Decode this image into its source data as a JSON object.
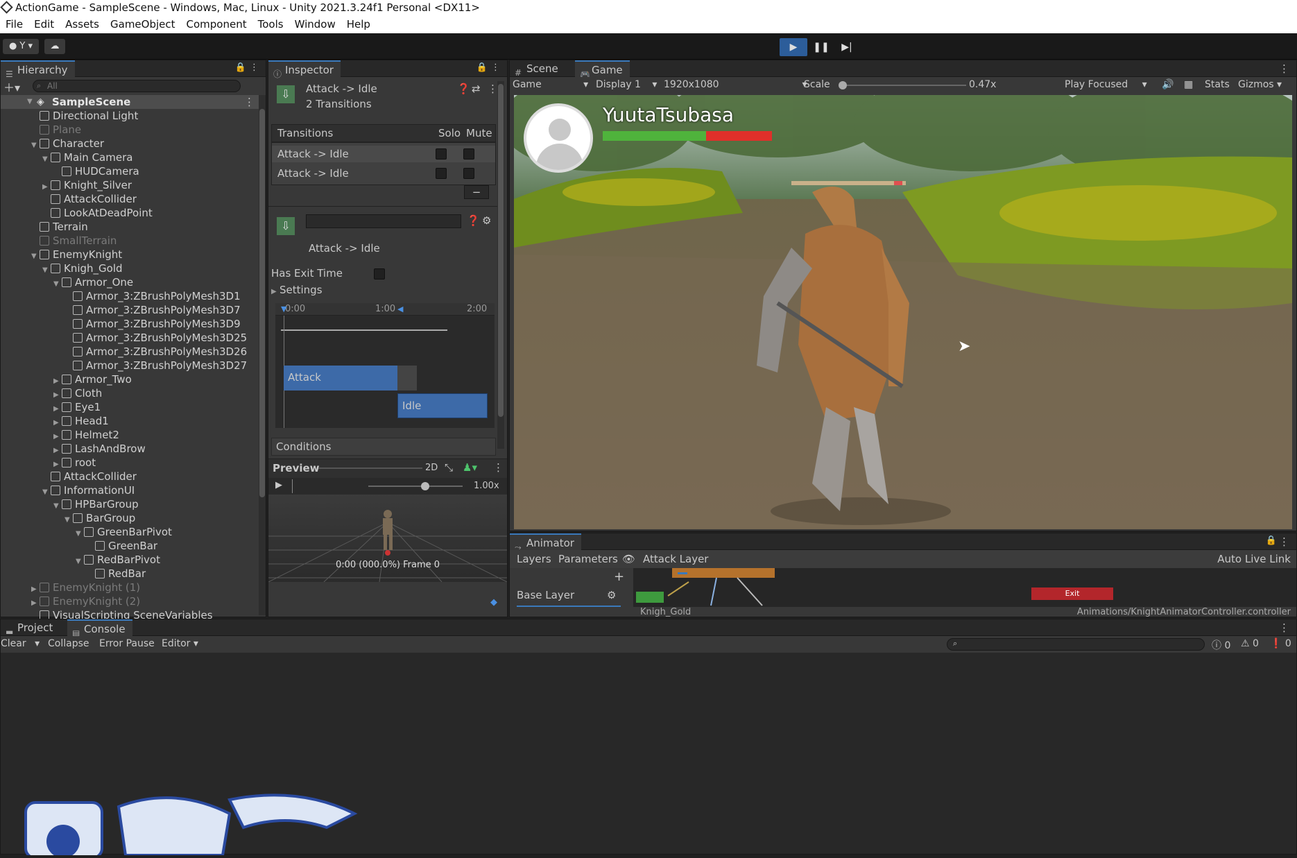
{
  "title_bar": {
    "text": "ActionGame - SampleScene - Windows, Mac, Linux - Unity 2021.3.24f1 Personal <DX11>"
  },
  "menu": [
    "File",
    "Edit",
    "Assets",
    "GameObject",
    "Component",
    "Tools",
    "Window",
    "Help"
  ],
  "toolbar": {
    "account_label": "Y",
    "play_icon": "play-icon",
    "pause_icon": "pause-icon",
    "step_icon": "step-icon"
  },
  "hierarchy": {
    "tab_label": "Hierarchy",
    "search_placeholder": "All",
    "scene_name": "SampleScene",
    "items": [
      {
        "label": "Directional Light",
        "depth": 1,
        "expand": "",
        "dim": false
      },
      {
        "label": "Plane",
        "depth": 1,
        "expand": "",
        "dim": true
      },
      {
        "label": "Character",
        "depth": 1,
        "expand": "open",
        "dim": false
      },
      {
        "label": "Main Camera",
        "depth": 2,
        "expand": "open",
        "dim": false
      },
      {
        "label": "HUDCamera",
        "depth": 3,
        "expand": "",
        "dim": false
      },
      {
        "label": "Knight_Silver",
        "depth": 2,
        "expand": "closed",
        "dim": false
      },
      {
        "label": "AttackCollider",
        "depth": 2,
        "expand": "",
        "dim": false
      },
      {
        "label": "LookAtDeadPoint",
        "depth": 2,
        "expand": "",
        "dim": false
      },
      {
        "label": "Terrain",
        "depth": 1,
        "expand": "",
        "dim": false
      },
      {
        "label": "SmallTerrain",
        "depth": 1,
        "expand": "",
        "dim": true
      },
      {
        "label": "EnemyKnight",
        "depth": 1,
        "expand": "open",
        "dim": false
      },
      {
        "label": "Knigh_Gold",
        "depth": 2,
        "expand": "open",
        "dim": false
      },
      {
        "label": "Armor_One",
        "depth": 3,
        "expand": "open",
        "dim": false
      },
      {
        "label": "Armor_3:ZBrushPolyMesh3D1",
        "depth": 4,
        "expand": "",
        "dim": false
      },
      {
        "label": "Armor_3:ZBrushPolyMesh3D7",
        "depth": 4,
        "expand": "",
        "dim": false
      },
      {
        "label": "Armor_3:ZBrushPolyMesh3D9",
        "depth": 4,
        "expand": "",
        "dim": false
      },
      {
        "label": "Armor_3:ZBrushPolyMesh3D25",
        "depth": 4,
        "expand": "",
        "dim": false
      },
      {
        "label": "Armor_3:ZBrushPolyMesh3D26",
        "depth": 4,
        "expand": "",
        "dim": false
      },
      {
        "label": "Armor_3:ZBrushPolyMesh3D27",
        "depth": 4,
        "expand": "",
        "dim": false
      },
      {
        "label": "Armor_Two",
        "depth": 3,
        "expand": "closed",
        "dim": false
      },
      {
        "label": "Cloth",
        "depth": 3,
        "expand": "closed",
        "dim": false
      },
      {
        "label": "Eye1",
        "depth": 3,
        "expand": "closed",
        "dim": false
      },
      {
        "label": "Head1",
        "depth": 3,
        "expand": "closed",
        "dim": false
      },
      {
        "label": "Helmet2",
        "depth": 3,
        "expand": "closed",
        "dim": false
      },
      {
        "label": "LashAndBrow",
        "depth": 3,
        "expand": "closed",
        "dim": false
      },
      {
        "label": "root",
        "depth": 3,
        "expand": "closed",
        "dim": false
      },
      {
        "label": "AttackCollider",
        "depth": 2,
        "expand": "",
        "dim": false
      },
      {
        "label": "InformationUI",
        "depth": 2,
        "expand": "open",
        "dim": false
      },
      {
        "label": "HPBarGroup",
        "depth": 3,
        "expand": "open",
        "dim": false
      },
      {
        "label": "BarGroup",
        "depth": 4,
        "expand": "open",
        "dim": false
      },
      {
        "label": "GreenBarPivot",
        "depth": 5,
        "expand": "open",
        "dim": false
      },
      {
        "label": "GreenBar",
        "depth": 6,
        "expand": "",
        "dim": false
      },
      {
        "label": "RedBarPivot",
        "depth": 5,
        "expand": "open",
        "dim": false
      },
      {
        "label": "RedBar",
        "depth": 6,
        "expand": "",
        "dim": false
      },
      {
        "label": "EnemyKnight (1)",
        "depth": 1,
        "expand": "closed",
        "dim": true
      },
      {
        "label": "EnemyKnight (2)",
        "depth": 1,
        "expand": "closed",
        "dim": true
      },
      {
        "label": "VisualScripting SceneVariables",
        "depth": 1,
        "expand": "",
        "dim": false
      }
    ]
  },
  "inspector": {
    "tab_label": "Inspector",
    "header_title": "Attack -> Idle",
    "header_subtitle": "2 Transitions",
    "transitions_header": "Transitions",
    "solo_label": "Solo",
    "mute_label": "Mute",
    "transitions": [
      "Attack -> Idle",
      "Attack -> Idle"
    ],
    "minus_label": "−",
    "transition_name": "Attack -> Idle",
    "has_exit_time_label": "Has Exit Time",
    "settings_label": "Settings",
    "timeline_ticks": [
      "0:00",
      "1:00",
      "2:00"
    ],
    "attack_clip": "Attack",
    "idle_clip": "Idle",
    "conditions_label": "Conditions",
    "preview_label": "Preview",
    "preview_2d": "2D",
    "preview_speed": "1.00x",
    "preview_frame": "0:00 (000.0%) Frame 0"
  },
  "game": {
    "scene_tab": "Scene",
    "game_tab": "Game",
    "mode": "Game",
    "display": "Display 1",
    "resolution": "1920x1080",
    "scale_label": "Scale",
    "scale_value": "0.47x",
    "play_focused": "Play Focused",
    "stats": "Stats",
    "gizmos": "Gizmos",
    "player_name": "YuutaTsubasa",
    "player_hp_fraction": 0.61,
    "enemy_hp_fraction": 0.95
  },
  "animator": {
    "tab_label": "Animator",
    "layers_tab": "Layers",
    "parameters_tab": "Parameters",
    "breadcrumb": "Attack Layer",
    "auto_live_link": "Auto Live Link",
    "plus_label": "+",
    "base_layer": "Base Layer",
    "exit_node": "Exit",
    "object_name": "Knigh_Gold",
    "controller_path": "Animations/KnightAnimatorController.controller"
  },
  "console": {
    "project_tab": "Project",
    "console_tab": "Console",
    "clear": "Clear",
    "collapse": "Collapse",
    "error_pause": "Error Pause",
    "editor": "Editor",
    "info_count": "0",
    "warn_count": "0",
    "error_count": "0"
  },
  "colors": {
    "accent": "#3a79bb",
    "green_bar": "#4fb33c",
    "red_bar": "#e0302a",
    "attack_clip": "#3d6aa8",
    "exit_node": "#b3262b"
  }
}
